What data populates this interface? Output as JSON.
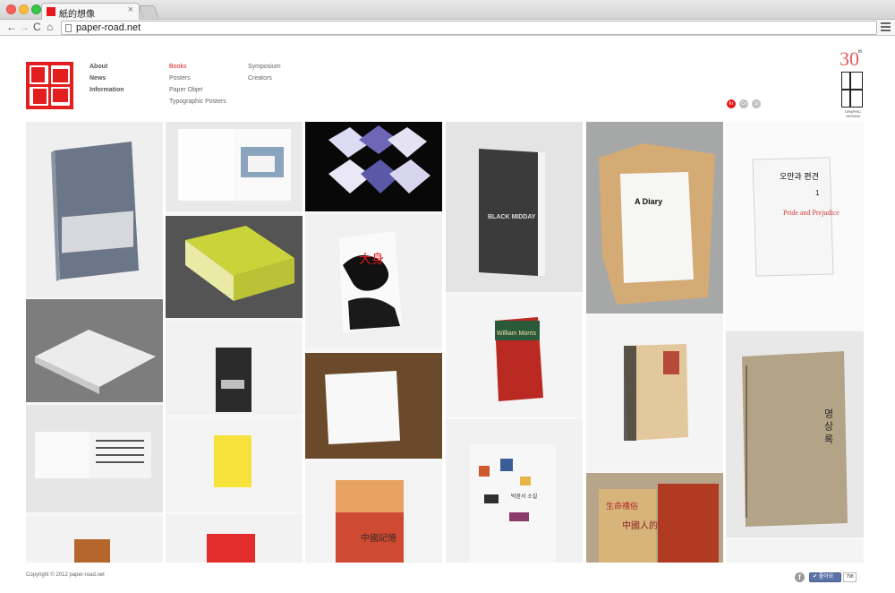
{
  "browser": {
    "tab_title": "紙的想像",
    "tab_close": "×",
    "url": "paper-road.net",
    "back": "←",
    "forward": "→",
    "reload": "C",
    "home": "⌂"
  },
  "nav": {
    "col1": [
      "About",
      "News",
      "Information"
    ],
    "col2": [
      "Books",
      "Posters",
      "Paper Objet",
      "Typographic Posters"
    ],
    "col3": [
      "Symposium",
      "Creators"
    ],
    "active": "Books"
  },
  "anniversary": {
    "number": "30",
    "suffix": "th",
    "caption": "GRAPHIC DESIGN"
  },
  "languages": [
    "Kr",
    "Cn",
    "Jp"
  ],
  "grid_text": {
    "black_midday": "BLACK MIDDAY",
    "a_diary": "A Diary",
    "pride_kr": "오만과 편견",
    "pride_vol": "1",
    "pride_en": "Pride and Prejudice",
    "william_morris": "William Morris",
    "daishin": "大身",
    "kr_vertical": "명 상 록",
    "kr_book": "박완서 소설",
    "chinese": "中國人的",
    "seimei": "生命禮俗",
    "kiroku": "中國記憶"
  },
  "footer": {
    "copyright": "Copyright © 2012 paper-road.net",
    "fb": "f",
    "like_label": "✔ 좋아요",
    "like_count": "798"
  }
}
